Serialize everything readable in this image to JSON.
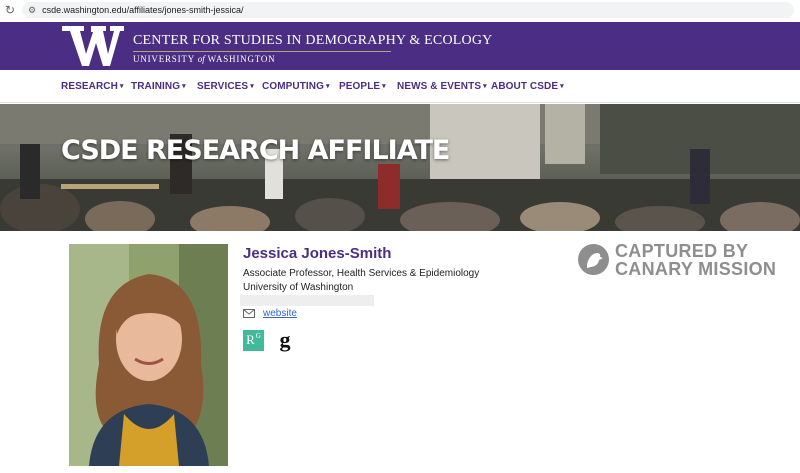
{
  "browser": {
    "url": "csde.washington.edu/affiliates/jones-smith-jessica/",
    "reload_icon": "reload-icon",
    "site_info_icon": "tune-icon"
  },
  "header": {
    "logo_letter": "W",
    "title": "CENTER FOR STUDIES IN DEMOGRAPHY & ECOLOGY",
    "subtitle_pre": "UNIVERSITY",
    "subtitle_of": "of",
    "subtitle_post": "WASHINGTON",
    "brand_color": "#4b2e83",
    "gold_color": "#b7a57a"
  },
  "nav": {
    "items": [
      {
        "label": "RESEARCH"
      },
      {
        "label": "TRAINING"
      },
      {
        "label": "SERVICES"
      },
      {
        "label": "COMPUTING"
      },
      {
        "label": "PEOPLE"
      },
      {
        "label": "NEWS & EVENTS"
      },
      {
        "label": "ABOUT CSDE"
      }
    ],
    "caret": "▾"
  },
  "hero": {
    "title": "CSDE RESEARCH AFFILIATE"
  },
  "profile": {
    "name": "Jessica Jones-Smith",
    "role": "Associate Professor, Health Services & Epidemiology",
    "institution": "University of Washington",
    "website_label": "website",
    "mail_icon": "envelope-icon",
    "researchgate_label": "R",
    "researchgate_sup": "G",
    "scholar_label": "g"
  },
  "watermark": {
    "line1": "CAPTURED BY",
    "line2": "CANARY MISSION"
  }
}
